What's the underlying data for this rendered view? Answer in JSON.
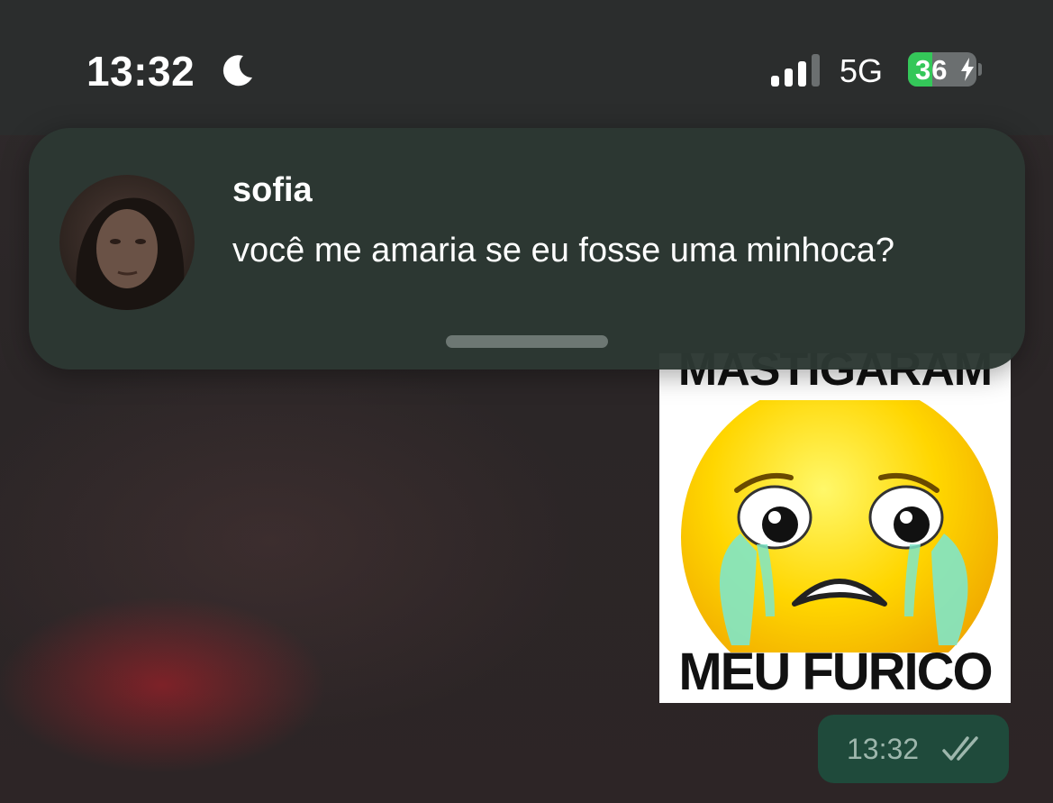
{
  "status_bar": {
    "time": "13:32",
    "focus_icon": "moon-icon",
    "signal_icon": "cellular-signal-icon",
    "network": "5G",
    "battery_level": "36",
    "battery_percent": 36,
    "charging_icon": "bolt-icon"
  },
  "notification": {
    "sender": "sofia",
    "message": "você me amaria se eu fosse uma minhoca?",
    "avatar": "contact-photo"
  },
  "chat": {
    "image_message": {
      "top_text": "MASTIGARAM",
      "bottom_text": "MEU FURICO",
      "emoji": "crying-face"
    },
    "timestamp": "13:32",
    "status_icon": "double-check-icon"
  },
  "colors": {
    "notification_bg": "#2c3833",
    "outgoing_bubble": "#1f4a3b",
    "battery_green": "#34c759"
  }
}
